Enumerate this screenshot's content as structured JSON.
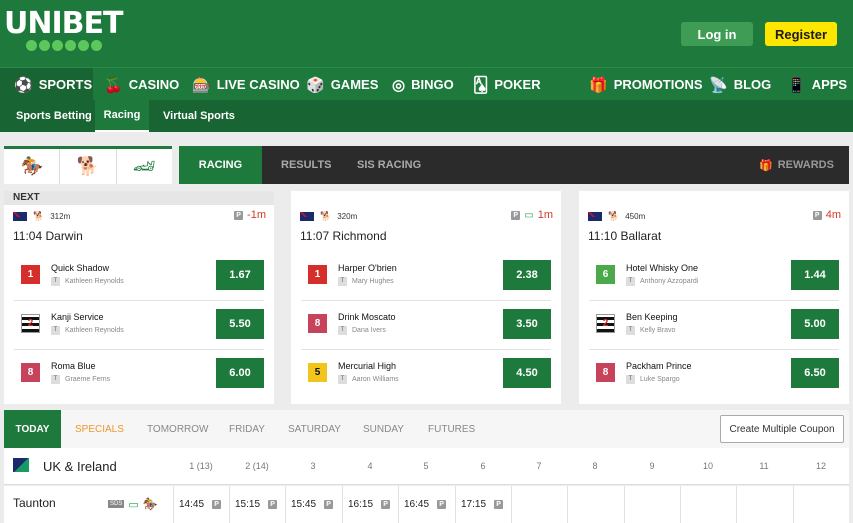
{
  "brand": {
    "name": "UNIBET"
  },
  "auth": {
    "login": "Log in",
    "register": "Register"
  },
  "nav": [
    {
      "label": "SPORTS",
      "icon": "⚽"
    },
    {
      "label": "CASINO",
      "icon": "🍒"
    },
    {
      "label": "LIVE CASINO",
      "icon": "🎰"
    },
    {
      "label": "GAMES",
      "icon": "🎲"
    },
    {
      "label": "BINGO",
      "icon": "◎"
    },
    {
      "label": "POKER",
      "icon": "🂡"
    },
    {
      "label": "PROMOTIONS",
      "icon": "🎁"
    },
    {
      "label": "BLOG",
      "icon": "📡"
    },
    {
      "label": "APPS",
      "icon": "📱"
    }
  ],
  "subnav": [
    "Sports Betting",
    "Racing",
    "Virtual Sports"
  ],
  "racing_tabs": {
    "racing": "RACING",
    "results": "RESULTS",
    "sis": "SIS RACING",
    "rewards": "REWARDS"
  },
  "cards": [
    {
      "next": "NEXT",
      "distance": "312m",
      "timer": "-1m",
      "venue": "11:04 Darwin",
      "runners": [
        {
          "num": "1",
          "name": "Quick Shadow",
          "trainer": "Kathleen Reynolds",
          "odds": "1.67",
          "tag": "T"
        },
        {
          "num": "2",
          "name": "Kanji Service",
          "trainer": "Kathleen Reynolds",
          "odds": "5.50",
          "tag": "T"
        },
        {
          "num": "8",
          "name": "Roma Blue",
          "trainer": "Graeme Ferns",
          "odds": "6.00",
          "tag": "T"
        }
      ]
    },
    {
      "distance": "320m",
      "timer": "1m",
      "venue": "11:07 Richmond",
      "runners": [
        {
          "num": "1",
          "name": "Harper O'brien",
          "trainer": "Mary Hughes",
          "odds": "2.38",
          "tag": "T"
        },
        {
          "num": "8",
          "name": "Drink Moscato",
          "trainer": "Dana Ivers",
          "odds": "3.50",
          "tag": "T"
        },
        {
          "num": "5",
          "name": "Mercurial High",
          "trainer": "Aaron Williams",
          "odds": "4.50",
          "tag": "T"
        }
      ]
    },
    {
      "distance": "450m",
      "timer": "4m",
      "venue": "11:10 Ballarat",
      "runners": [
        {
          "num": "6",
          "name": "Hotel Whisky One",
          "trainer": "Anthony Azzopardi",
          "odds": "1.44",
          "tag": "T"
        },
        {
          "num": "2",
          "name": "Ben Keeping",
          "trainer": "Kelly Bravo",
          "odds": "5.00",
          "tag": "T"
        },
        {
          "num": "8",
          "name": "Packham Prince",
          "trainer": "Luke Spargo",
          "odds": "6.50",
          "tag": "T"
        }
      ]
    }
  ],
  "p_badge": "P",
  "days": [
    "TODAY",
    "SPECIALS",
    "TOMORROW",
    "FRIDAY",
    "SATURDAY",
    "SUNDAY",
    "FUTURES"
  ],
  "coupon": "Create Multiple Coupon",
  "region": {
    "title": "UK & Ireland",
    "cols": [
      "1 (13)",
      "2 (14)",
      "3",
      "4",
      "5",
      "6",
      "7",
      "8",
      "9",
      "10",
      "11",
      "12"
    ]
  },
  "meeting": {
    "name": "Taunton",
    "sis": "SDS",
    "times": [
      "14:45",
      "15:15",
      "15:45",
      "16:15",
      "16:45",
      "17:15"
    ]
  }
}
